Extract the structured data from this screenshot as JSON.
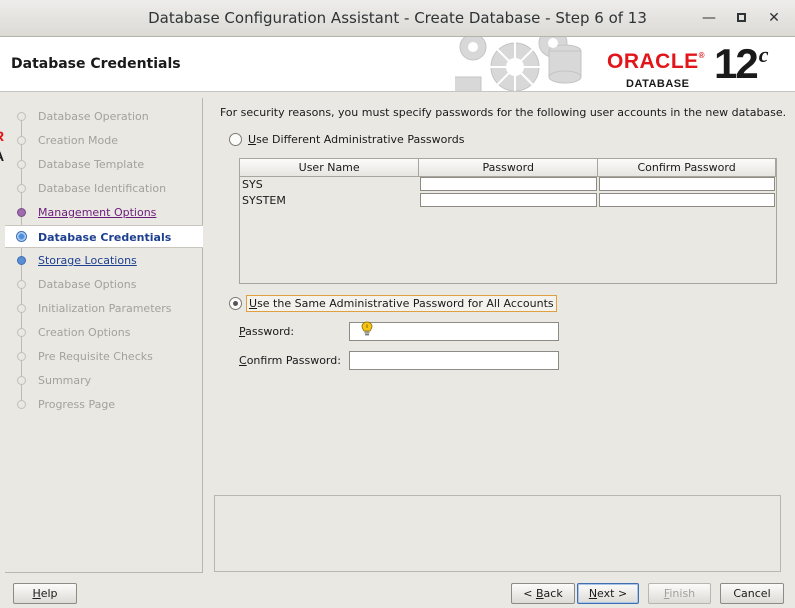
{
  "window": {
    "title": "Database Configuration Assistant - Create Database - Step 6 of 13",
    "minimize_glyph": "—",
    "close_glyph": "✕"
  },
  "header": {
    "page_title": "Database Credentials",
    "logo_word": "ORACLE",
    "logo_registered": "®",
    "logo_sub": "DATABASE",
    "version_number": "12",
    "version_suffix": "c"
  },
  "left_edge_fragments": [
    "R",
    "A"
  ],
  "nav": {
    "items": [
      {
        "label": "Database Operation",
        "state": "disabled"
      },
      {
        "label": "Creation Mode",
        "state": "disabled"
      },
      {
        "label": "Database Template",
        "state": "disabled"
      },
      {
        "label": "Database Identification",
        "state": "disabled"
      },
      {
        "label": "Management Options",
        "state": "visited"
      },
      {
        "label": "Database Credentials",
        "state": "current"
      },
      {
        "label": "Storage Locations",
        "state": "link"
      },
      {
        "label": "Database Options",
        "state": "disabled"
      },
      {
        "label": "Initialization Parameters",
        "state": "disabled"
      },
      {
        "label": "Creation Options",
        "state": "disabled"
      },
      {
        "label": "Pre Requisite Checks",
        "state": "disabled"
      },
      {
        "label": "Summary",
        "state": "disabled"
      },
      {
        "label": "Progress Page",
        "state": "disabled"
      }
    ]
  },
  "main": {
    "intro_text": "For security reasons, you must specify passwords for the following user accounts in the new database.",
    "option_different": {
      "mnemonic": "U",
      "rest": "se Different Administrative Passwords",
      "checked": false
    },
    "grid": {
      "columns": [
        "User Name",
        "Password",
        "Confirm Password"
      ],
      "rows": [
        {
          "user": "SYS",
          "password": "",
          "confirm": ""
        },
        {
          "user": "SYSTEM",
          "password": "",
          "confirm": ""
        }
      ]
    },
    "option_same": {
      "mnemonic": "U",
      "rest": "se the Same Administrative Password for All Accounts",
      "checked": true
    },
    "password_field": {
      "mnemonic": "P",
      "rest": "assword:",
      "value": ""
    },
    "confirm_field": {
      "mnemonic": "C",
      "rest": "onfirm Password:",
      "value": ""
    }
  },
  "buttons": {
    "help": {
      "mnemonic": "H",
      "rest": "elp"
    },
    "back": {
      "prefix": "< ",
      "mnemonic": "B",
      "rest": "ack"
    },
    "next": {
      "mnemonic": "N",
      "rest": "ext >"
    },
    "finish": {
      "mnemonic": "F",
      "rest": "inish"
    },
    "cancel": {
      "label": "Cancel"
    }
  },
  "colors": {
    "oracle_red": "#e2161a",
    "link_blue": "#1d3f8f",
    "visited_purple": "#6a1b7a",
    "focus_outline": "#e0a040"
  }
}
